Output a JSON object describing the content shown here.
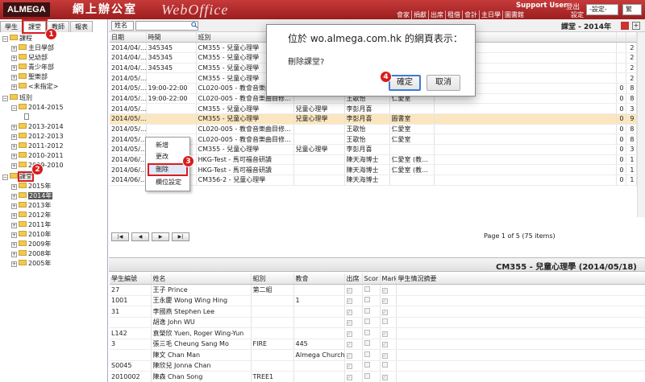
{
  "header": {
    "brand": "ALMEGA",
    "chinese_title": "網上辦公室",
    "product": "WebOffice",
    "support_user": "Support User",
    "logout": "登出",
    "setting": "設定",
    "settings_select": "-設定-",
    "lang_select": "繁",
    "menu": [
      "會家",
      "捐獻",
      "出席",
      "租借",
      "會計",
      "主日學",
      "圖書館"
    ]
  },
  "left_tabs": [
    "學生",
    "課堂",
    "教師",
    "報表"
  ],
  "tree": {
    "courses_root": "課程",
    "courses": [
      "主日學部",
      "兒幼部",
      "青少年部",
      "聖樂部",
      "<未指定>"
    ],
    "classes_root": "班別",
    "class_years": [
      "2014-2015",
      "2013-2014",
      "2012-2013",
      "2011-2012",
      "2010-2011",
      "2009-2010"
    ],
    "lessons_root": "課堂",
    "lesson_years": [
      "2015年",
      "2014年",
      "2013年",
      "2012年",
      "2011年",
      "2010年",
      "2009年",
      "2008年",
      "2005年"
    ]
  },
  "toolbar": {
    "name_select": "姓名",
    "class_title": "課堂 - 2014年"
  },
  "grid": {
    "headers": [
      "日期",
      "時間",
      "班別",
      "",
      "",
      "",
      "",
      "",
      ""
    ],
    "rows": [
      [
        "2014/04/...",
        "345345",
        "CM355 - 兒童心理學",
        "",
        "",
        "",
        "",
        "",
        "2"
      ],
      [
        "2014/04/...",
        "345345",
        "CM355 - 兒童心理學",
        "",
        "",
        "",
        "",
        "",
        "2"
      ],
      [
        "2014/04/...",
        "345345",
        "CM355 - 兒童心理學",
        "",
        "",
        "",
        "",
        "",
        "2"
      ],
      [
        "2014/05/...",
        "",
        "CM355 - 兒童心理學",
        "",
        "",
        "",
        "",
        "",
        "2"
      ],
      [
        "2014/05/...",
        "19:00-22:00",
        "CL020-005 - 教會音樂曲目修...",
        "",
        "王歌怡",
        "仁愛室",
        "",
        "0",
        "8"
      ],
      [
        "2014/05/...",
        "19:00-22:00",
        "CL020-005 - 教會音樂曲目修...",
        "",
        "王歌怡",
        "仁愛室",
        "",
        "0",
        "8"
      ],
      [
        "2014/05/...",
        "",
        "CM355 - 兒童心理學",
        "兒童心理學",
        "李彭月喜",
        "",
        "",
        "0",
        "3"
      ],
      [
        "2014/05/...",
        "",
        "CM355 - 兒童心理學",
        "兒童心理學",
        "李彭月喜",
        "圖書室",
        "",
        "0",
        "9"
      ],
      [
        "2014/05/...",
        "",
        "CL020-005 - 教會音樂曲目修...",
        "",
        "王歌怡",
        "仁愛室",
        "",
        "0",
        "8"
      ],
      [
        "2014/05/...",
        "",
        "CL020-005 - 教會音樂曲目修...",
        "",
        "王歌怡",
        "仁愛室",
        "",
        "0",
        "8"
      ],
      [
        "2014/05/...",
        "",
        "CM355 - 兒童心理學",
        "兒童心理學",
        "李彭月喜",
        "",
        "",
        "0",
        "3"
      ],
      [
        "2014/06/...",
        "",
        "HKG-Test - 馬可福音研讀",
        "",
        "陳天海博士",
        "仁愛室 (教...",
        "",
        "0",
        "1"
      ],
      [
        "2014/06/...",
        "",
        "HKG-Test - 馬可福音研讀",
        "",
        "陳天海博士",
        "仁愛室 (教...",
        "",
        "0",
        "1"
      ],
      [
        "2014/06/...",
        "",
        "CM356-2 - 兒童心理學",
        "",
        "陳天海博士",
        "",
        "",
        "0",
        "1"
      ]
    ],
    "selected_row": 7
  },
  "pager": {
    "first": "|◀",
    "prev": "◀",
    "next": "▶",
    "last": "▶|",
    "info": "Page 1 of 5 (75 items)"
  },
  "context_menu": {
    "items": [
      "新增",
      "更改",
      "刪除",
      "欄位設定"
    ]
  },
  "dialog": {
    "title": "位於 wo.almega.com.hk 的網頁表示：",
    "message": "刪除課堂?",
    "ok": "確定",
    "cancel": "取消"
  },
  "bottom": {
    "title": "CM355 - 兒童心理學 (2014/05/18)",
    "headers": [
      "學生編號",
      "姓名",
      "組別",
      "教會",
      "出席",
      "Scor",
      "Mark",
      "學生情況摘要"
    ],
    "rows": [
      [
        "27",
        "王子 Prince",
        "第二組",
        "",
        "✓",
        "",
        "✓",
        ""
      ],
      [
        "1001",
        "王永慶 Wong Wing Hing",
        "",
        "1",
        "✓",
        "",
        "✓",
        ""
      ],
      [
        "31",
        "李國燕 Stephen Lee",
        "",
        "",
        "✓",
        "",
        "✓",
        ""
      ],
      [
        "",
        "胡逸 John WU",
        "",
        "",
        "✓",
        "",
        "",
        ""
      ],
      [
        "L142",
        "袁榮欣 Yuen, Roger Wing-Yun",
        "",
        "",
        "✓",
        "",
        "✓",
        ""
      ],
      [
        "3",
        "張三毛 Cheung Sang Mo",
        "FIRE",
        "445",
        "✓",
        "",
        "✓",
        ""
      ],
      [
        "",
        "陳文 Chan Man",
        "",
        "Almega Church",
        "✓",
        "",
        "✓",
        ""
      ],
      [
        "S0045",
        "陳欣兒 Jonna Chan",
        "",
        "",
        "✓",
        "",
        "",
        ""
      ],
      [
        "2010002",
        "陳森 Chan Song",
        "TREE1",
        "",
        "✓",
        "",
        "✓",
        ""
      ]
    ]
  },
  "callouts": [
    "1",
    "2",
    "3",
    "4"
  ],
  "colors": {
    "header_red": "#b52a2a",
    "callout_red": "#d91c1c",
    "selected_row": "#fbe6bf",
    "ok_border": "#3b7bd6"
  }
}
